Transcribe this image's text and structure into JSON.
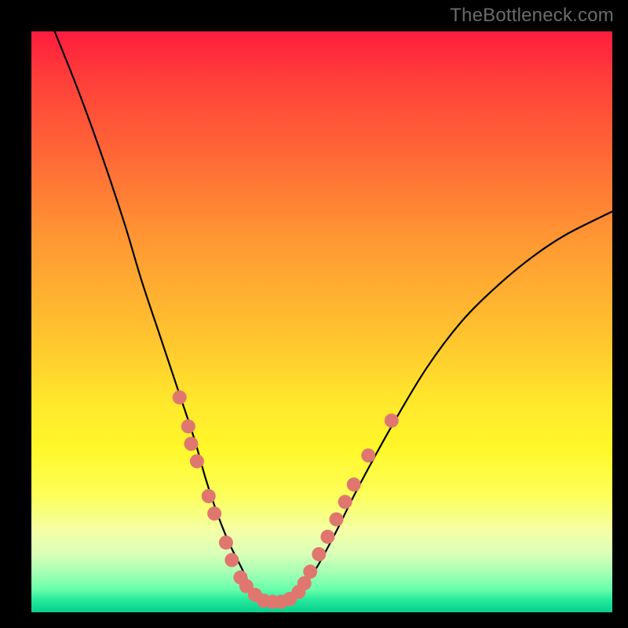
{
  "attribution": "TheBottleneck.com",
  "chart_data": {
    "type": "line",
    "title": "",
    "xlabel": "",
    "ylabel": "",
    "xlim": [
      0,
      100
    ],
    "ylim": [
      0,
      100
    ],
    "series": [
      {
        "name": "curve",
        "x": [
          4,
          8,
          12,
          16,
          19,
          22,
          25,
          28,
          30,
          32,
          34,
          36,
          38,
          40,
          44,
          48,
          52,
          56,
          62,
          68,
          74,
          80,
          86,
          92,
          100
        ],
        "y": [
          100,
          90,
          79,
          67,
          57,
          48,
          39,
          30,
          23,
          17,
          12,
          8,
          4,
          2,
          2,
          6,
          13,
          21,
          32,
          42,
          50,
          56,
          61,
          65,
          69
        ]
      }
    ],
    "markers": [
      {
        "x": 25.5,
        "y": 37
      },
      {
        "x": 27.0,
        "y": 32
      },
      {
        "x": 27.5,
        "y": 29
      },
      {
        "x": 28.5,
        "y": 26
      },
      {
        "x": 30.5,
        "y": 20
      },
      {
        "x": 31.5,
        "y": 17
      },
      {
        "x": 33.5,
        "y": 12
      },
      {
        "x": 34.5,
        "y": 9
      },
      {
        "x": 36.0,
        "y": 6
      },
      {
        "x": 37.0,
        "y": 4.5
      },
      {
        "x": 38.5,
        "y": 3
      },
      {
        "x": 40.0,
        "y": 2
      },
      {
        "x": 41.5,
        "y": 1.8
      },
      {
        "x": 43.0,
        "y": 1.8
      },
      {
        "x": 44.5,
        "y": 2.3
      },
      {
        "x": 46.0,
        "y": 3.5
      },
      {
        "x": 47.0,
        "y": 5
      },
      {
        "x": 48.0,
        "y": 7
      },
      {
        "x": 49.5,
        "y": 10
      },
      {
        "x": 51.0,
        "y": 13
      },
      {
        "x": 52.5,
        "y": 16
      },
      {
        "x": 54.0,
        "y": 19
      },
      {
        "x": 55.5,
        "y": 22
      },
      {
        "x": 58.0,
        "y": 27
      },
      {
        "x": 62.0,
        "y": 33
      }
    ],
    "marker_color": "#e0776f",
    "curve_color": "#000000"
  }
}
